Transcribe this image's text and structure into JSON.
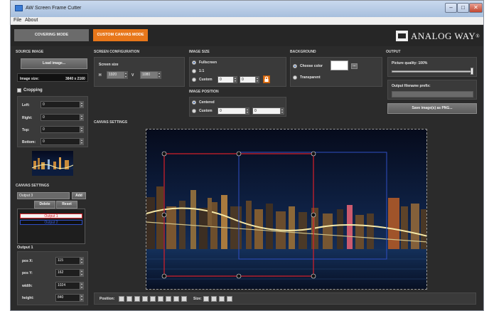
{
  "window": {
    "title": "AW Screen Frame Cutter",
    "controls": [
      "minimize",
      "maximize",
      "close"
    ]
  },
  "menu": [
    "File",
    "About"
  ],
  "tabs": [
    {
      "label": "COVERING MODE",
      "active": false
    },
    {
      "label": "CUSTOM CANVAS MODE",
      "active": true
    }
  ],
  "brand": {
    "name": "ANALOG WAY",
    "mark": "®"
  },
  "source": {
    "section": "SOURCE IMAGE",
    "load_button": "Load image...",
    "size_label": "Image size:",
    "size_value": "3840 x 2160",
    "cropping_label": "Cropping",
    "cropping_checked": false,
    "crop": {
      "left_label": "Left:",
      "left": "0",
      "right_label": "Right:",
      "right": "0",
      "top_label": "Top:",
      "top": "0",
      "bottom_label": "Bottom:",
      "bottom": "0"
    }
  },
  "screen": {
    "section": "SCREEN CONFIGURATION",
    "size_label": "Screen size",
    "h_label": "H",
    "h_value": "1920",
    "v_label": "V",
    "v_value": "1080"
  },
  "image_size": {
    "section": "IMAGE SIZE",
    "fullscreen": "Fullscreen",
    "one_to_one": "1:1",
    "custom": "Custom",
    "selected": "fullscreen",
    "custom_w": "0",
    "custom_h": "0"
  },
  "image_position": {
    "section": "IMAGE POSITION",
    "centered": "Centered",
    "custom": "Custom",
    "selected": "centered",
    "custom_x": "0",
    "custom_y": "0"
  },
  "background": {
    "section": "BACKGROUND",
    "choose_color": "Choose color",
    "transparent": "Transparent",
    "selected": "choose_color",
    "color": "#ffffff",
    "picker_button": "..."
  },
  "output": {
    "section": "OUTPUT",
    "quality_label": "Picture quality: 100%",
    "quality": 1.0,
    "prefix_label": "Output filename prefix:",
    "prefix_value": "",
    "save_button": "Save image(s) as PNG..."
  },
  "canvas_settings": {
    "section": "CANVAS SETTINGS",
    "name_value": "Output 3",
    "add_button": "Add",
    "delete_button": "Delete",
    "reset_button": "Reset",
    "outputs": [
      {
        "label": "Output 1",
        "color": "#d9202a",
        "selected": true
      },
      {
        "label": "Output 2",
        "color": "#2f4fc4",
        "selected": false
      }
    ],
    "selected_heading": "Output 1",
    "pos_x_label": "pos X:",
    "pos_x": "115",
    "pos_y_label": "pos Y:",
    "pos_y": "162",
    "width_label": "width:",
    "width": "1024",
    "height_label": "height:",
    "height": "840"
  },
  "canvas_area": {
    "section": "CANVAS SETTINGS"
  },
  "toolbar": {
    "position_label": "Position:",
    "size_label": "Size:",
    "position_tools": [
      "align-top-left-icon",
      "align-top-center-icon",
      "align-top-right-icon",
      "align-middle-left-icon",
      "align-center-icon",
      "align-middle-right-icon",
      "align-bottom-left-icon",
      "align-bottom-center-icon",
      "align-bottom-right-icon"
    ],
    "size_tools": [
      "fit-width-icon",
      "fit-height-icon",
      "fit-both-icon",
      "fill-icon"
    ]
  },
  "colors": {
    "accent": "#e8771a",
    "output1_frame": "#d9202a",
    "output2_frame": "#2f4fc4"
  }
}
